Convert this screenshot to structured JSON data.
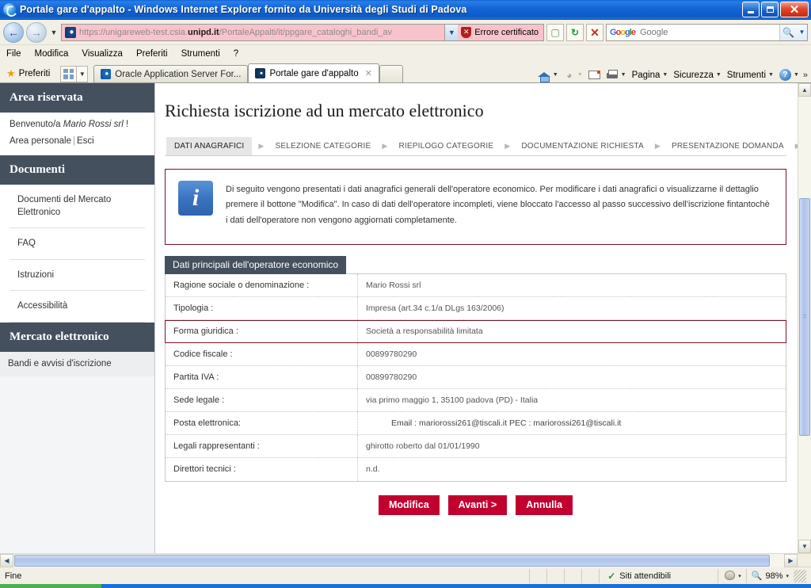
{
  "window": {
    "title": "Portale gare d'appalto - Windows Internet Explorer fornito da Università degli Studi di Padova",
    "icon": "ie-logo-icon",
    "minimize_label": "Riduci a icona",
    "maximize_label": "Ripristina",
    "close_label": "Chiudi"
  },
  "navbar": {
    "back_label": "←",
    "forward_label": "→",
    "history_caret": "▾",
    "url_prefix": "https://unigareweb-test.csia.",
    "url_domain": "unipd.it",
    "url_suffix": "/PortaleAppalti/it/ppgare_cataloghi_bandi_av",
    "address_dropdown": "▾",
    "cert_error_label": "Errore certificato",
    "compat_view_label": "Visualizzazione compatibilità",
    "refresh_label": "↻",
    "stop_label": "✕",
    "search_placeholder": "Google",
    "search_value": "",
    "search_go_label": "🔍",
    "search_provider_dropdown": "▾"
  },
  "menubar": {
    "items": [
      "File",
      "Modifica",
      "Visualizza",
      "Preferiti",
      "Strumenti",
      "?"
    ]
  },
  "favorites_bar": {
    "favorites_label": "Preferiti",
    "quicklaunch_caret": "▾"
  },
  "tabs": [
    {
      "label": "Oracle Application Server For...",
      "active": false,
      "icon": "ie-page-icon"
    },
    {
      "label": "Portale gare d'appalto",
      "active": true,
      "icon": "site-page-icon",
      "close": "✕"
    }
  ],
  "command_bar": {
    "home_label": "Pagina iniziale",
    "feeds_label": "Feed",
    "mail_label": "Posta",
    "print_label": "Stampa",
    "page_label": "Pagina",
    "safety_label": "Sicurezza",
    "tools_label": "Strumenti",
    "help_label": "?",
    "overflow_label": "»",
    "caret": "▾"
  },
  "sidebar": {
    "sections": [
      {
        "heading": "Area riservata",
        "welcome_prefix": "Benvenuto/a ",
        "welcome_user": "Mario Rossi srl",
        "welcome_suffix": " !",
        "links": [
          {
            "label": "Area personale"
          },
          {
            "label": "Esci"
          }
        ],
        "separator": "|"
      },
      {
        "heading": "Documenti",
        "items": [
          {
            "label": "Documenti del Mercato Elettronico",
            "selected": false
          },
          {
            "label": "FAQ",
            "selected": false
          },
          {
            "label": "Istruzioni",
            "selected": false
          },
          {
            "label": "Accessibilità",
            "selected": false
          }
        ]
      },
      {
        "heading": "Mercato elettronico",
        "items": [
          {
            "label": "Bandi e avvisi d'iscrizione",
            "selected": true
          }
        ]
      }
    ]
  },
  "main": {
    "page_title": "Richiesta iscrizione ad un mercato elettronico",
    "steps": [
      {
        "label": "DATI ANAGRAFICI",
        "active": true
      },
      {
        "label": "SELEZIONE CATEGORIE",
        "active": false
      },
      {
        "label": "RIEPILOGO CATEGORIE",
        "active": false
      },
      {
        "label": "DOCUMENTAZIONE RICHIESTA",
        "active": false
      },
      {
        "label": "PRESENTAZIONE DOMANDA",
        "active": false
      }
    ],
    "step_arrow": "▶",
    "info_box": {
      "icon": "info-icon",
      "icon_glyph": "i",
      "text": "Di seguito vengono presentati i dati anagrafici generali dell'operatore economico. Per modificare i dati anagrafici o visualizzarne il dettaglio premere il bottone \"Modifica\". In caso di dati dell'operatore incompleti, viene bloccato l'accesso al passo successivo dell'iscrizione fintantochè i dati dell'operatore non vengono aggiornati completamente."
    },
    "panel": {
      "legend": "Dati principali dell'operatore economico",
      "rows": [
        {
          "label": "Ragione sociale o denominazione :",
          "value": "Mario Rossi srl",
          "highlighted": false
        },
        {
          "label": "Tipologia :",
          "value": "Impresa (art.34 c.1/a DLgs 163/2006)",
          "highlighted": false
        },
        {
          "label": "Forma giuridica :",
          "value": "Società a responsabilità limitata",
          "highlighted": true
        },
        {
          "label": "Codice fiscale :",
          "value": "00899780290",
          "highlighted": false
        },
        {
          "label": "Partita IVA :",
          "value": "00899780290",
          "highlighted": false
        },
        {
          "label": "Sede legale :",
          "value": "via primo maggio 1, 35100 padova (PD) - Italia",
          "highlighted": false
        },
        {
          "label": "Posta elettronica:",
          "value": "Email :  mariorossi261@tiscali.it  PEC :   mariorossi261@tiscali.it",
          "highlighted": false,
          "indent": true
        },
        {
          "label": "Legali rappresentanti :",
          "value": "ghirotto roberto dal 01/01/1990",
          "highlighted": false
        },
        {
          "label": "Direttori tecnici :",
          "value": "n.d.",
          "highlighted": false
        }
      ]
    },
    "buttons": [
      {
        "label": "Modifica",
        "name": "modifica-button"
      },
      {
        "label": "Avanti >",
        "name": "avanti-button"
      },
      {
        "label": "Annulla",
        "name": "annulla-button"
      }
    ]
  },
  "scrollbars": {
    "up_arrow": "▲",
    "down_arrow": "▼",
    "left_arrow": "◀",
    "right_arrow": "▶"
  },
  "statusbar": {
    "status_text": "Fine",
    "zone_label": "Siti attendibili",
    "zone_check": "✓",
    "protected_caret": "▾",
    "zoom_level": "98%",
    "zoom_caret": "▾"
  },
  "colors": {
    "accent_red": "#c2002f",
    "panel_dark": "#44505e",
    "title_blue": "#1666d8",
    "highlight_border": "#7b1228",
    "info_blue": "#3a73c0"
  }
}
